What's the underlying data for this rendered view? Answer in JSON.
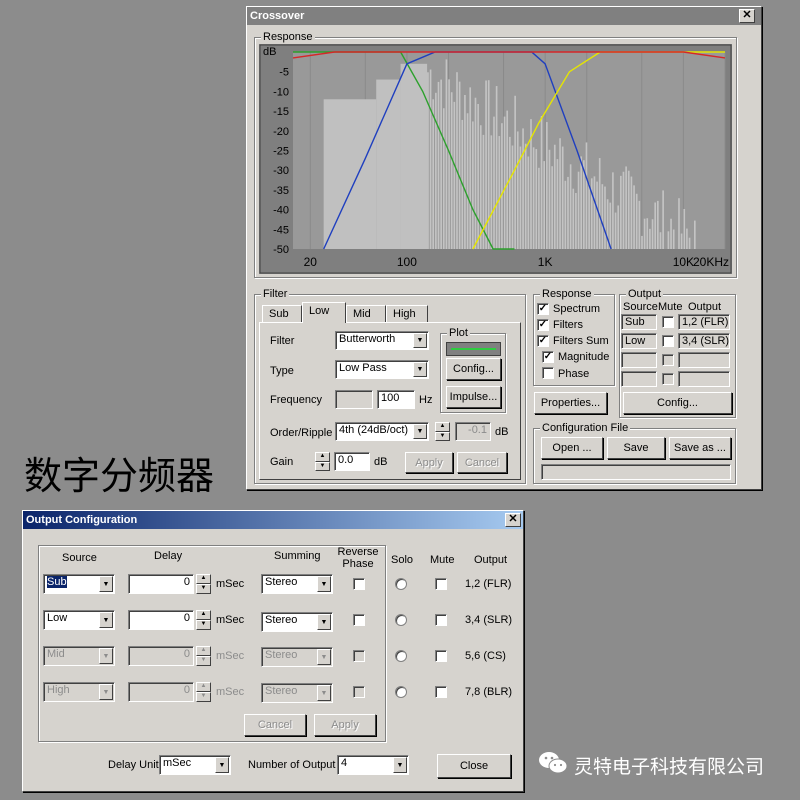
{
  "crossover": {
    "title": "Crossover",
    "response_group": "Response",
    "chart_data": {
      "type": "line",
      "title": "",
      "ylabel": "dB",
      "y_ticks": [
        "-5",
        "-10",
        "-15",
        "-20",
        "-25",
        "-30",
        "-35",
        "-40",
        "-45",
        "-50"
      ],
      "x_ticks": [
        "20",
        "100",
        "1K",
        "10K",
        "20KHz"
      ],
      "ylim": [
        -50,
        0
      ],
      "xlim": [
        15,
        20000
      ],
      "x_scale": "log",
      "series": [
        {
          "color": "#2ca02c",
          "x": [
            15,
            90,
            130,
            200,
            300,
            420,
            600
          ],
          "y": [
            0,
            0,
            -10,
            -25,
            -40,
            -50,
            -50
          ]
        },
        {
          "color": "#1f3fbf",
          "x": [
            25,
            50,
            100,
            160,
            800,
            1000,
            1700,
            3000
          ],
          "y": [
            -50,
            -27,
            -3,
            0,
            0,
            -3,
            -25,
            -50
          ]
        },
        {
          "color": "#e6e600",
          "x": [
            300,
            600,
            900,
            1500,
            2500,
            20000
          ],
          "y": [
            -50,
            -30,
            -18,
            -5,
            0,
            0
          ]
        },
        {
          "color": "#d62728",
          "x": [
            15,
            30,
            100,
            1000,
            10000,
            20000
          ],
          "y": [
            -1.5,
            0,
            0,
            0,
            0,
            -1.5
          ]
        }
      ]
    },
    "filter": {
      "group": "Filter",
      "tabs": [
        "Sub",
        "Low",
        "Mid",
        "High"
      ],
      "filter_label": "Filter",
      "filter_value": "Butterworth",
      "type_label": "Type",
      "type_value": "Low Pass",
      "frequency_label": "Frequency",
      "frequency_value": "100",
      "frequency_unit": "Hz",
      "order_label": "Order/Ripple",
      "order_value": "4th (24dB/oct)",
      "ripple_value": "-0.1",
      "ripple_unit": "dB",
      "gain_label": "Gain",
      "gain_value": "0.0",
      "gain_unit": "dB",
      "apply": "Apply",
      "cancel": "Cancel",
      "plot_group": "Plot",
      "config": "Config...",
      "impulse": "Impulse..."
    },
    "response_options": {
      "group": "Response",
      "spectrum": "Spectrum",
      "filters": "Filters",
      "filters_sum": "Filters Sum",
      "magnitude": "Magnitude",
      "phase": "Phase",
      "properties": "Properties..."
    },
    "output": {
      "group": "Output",
      "col_source": "Source",
      "col_mute": "Mute",
      "col_output": "Output",
      "rows": [
        {
          "source": "Sub",
          "output": "1,2 (FLR)"
        },
        {
          "source": "Low",
          "output": "3,4 (SLR)"
        }
      ],
      "config": "Config..."
    },
    "config_file": {
      "group": "Configuration File",
      "open": "Open ...",
      "save": "Save",
      "save_as": "Save as ..."
    }
  },
  "overlay_text": "数字分频器",
  "output_config": {
    "title": "Output Configuration",
    "headers": {
      "source": "Source",
      "delay": "Delay",
      "summing": "Summing",
      "reverse": "Reverse Phase",
      "solo": "Solo",
      "mute": "Mute",
      "output": "Output"
    },
    "rows": [
      {
        "source": "Sub",
        "delay": "0",
        "unit": "mSec",
        "summing": "Stereo",
        "output": "1,2 (FLR)"
      },
      {
        "source": "Low",
        "delay": "0",
        "unit": "mSec",
        "summing": "Stereo",
        "output": "3,4 (SLR)"
      },
      {
        "source": "Mid",
        "delay": "0",
        "unit": "mSec",
        "summing": "Stereo",
        "output": "5,6 (CS)"
      },
      {
        "source": "High",
        "delay": "0",
        "unit": "mSec",
        "summing": "Stereo",
        "output": "7,8 (BLR)"
      }
    ],
    "cancel": "Cancel",
    "apply": "Apply",
    "delay_unit_label": "Delay Unit",
    "delay_unit_value": "mSec",
    "num_output_label": "Number of Output",
    "num_output_value": "4",
    "close": "Close"
  },
  "watermark": "灵特电子科技有限公司"
}
